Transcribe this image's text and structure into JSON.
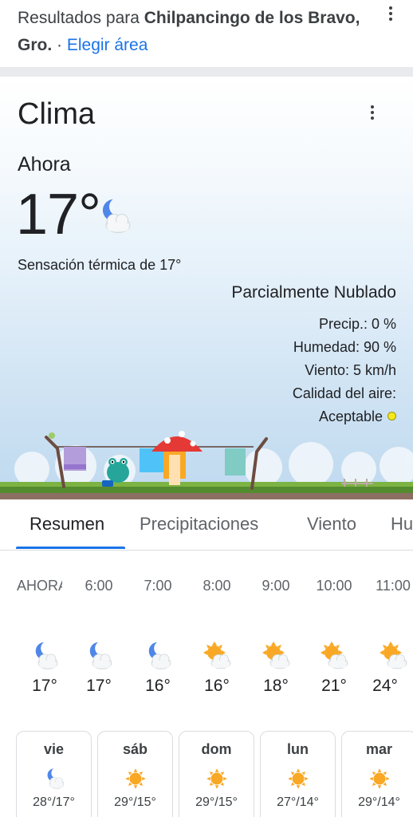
{
  "header": {
    "prefix": "Resultados para ",
    "location": "Chilpancingo de los Bravo, Gro.",
    "separator": " · ",
    "change_area": "Elegir área"
  },
  "weather": {
    "title": "Clima",
    "now_label": "Ahora",
    "temperature": "17°",
    "feels_like": "Sensación térmica de 17°",
    "condition": "Parcialmente Nublado",
    "precip": "Precip.: 0 %",
    "humidity": "Humedad: 90 %",
    "wind": "Viento: 5 km/h",
    "air_quality_label": "Calidad del aire:",
    "air_quality_value": "Aceptable",
    "air_quality_color": "#f8e71c",
    "now_icon": "partly-cloudy-night-icon"
  },
  "tabs": [
    {
      "label": "Resumen",
      "active": true
    },
    {
      "label": "Precipitaciones",
      "active": false
    },
    {
      "label": "Viento",
      "active": false
    },
    {
      "label": "Humedad",
      "active": false
    }
  ],
  "hourly": [
    {
      "time": "AHORA",
      "temp": "17°",
      "icon": "partly-cloudy-night-icon"
    },
    {
      "time": "6:00",
      "temp": "17°",
      "icon": "partly-cloudy-night-icon"
    },
    {
      "time": "7:00",
      "temp": "16°",
      "icon": "partly-cloudy-night-icon"
    },
    {
      "time": "8:00",
      "temp": "16°",
      "icon": "partly-cloudy-day-icon"
    },
    {
      "time": "9:00",
      "temp": "18°",
      "icon": "partly-cloudy-day-icon"
    },
    {
      "time": "10:00",
      "temp": "21°",
      "icon": "partly-cloudy-day-icon"
    },
    {
      "time": "11:00",
      "temp": "24°",
      "icon": "partly-cloudy-day-icon"
    }
  ],
  "daily": [
    {
      "day": "vie",
      "range": "28°/17°",
      "icon": "partly-cloudy-night-icon"
    },
    {
      "day": "sáb",
      "range": "29°/15°",
      "icon": "sunny-icon"
    },
    {
      "day": "dom",
      "range": "29°/15°",
      "icon": "sunny-icon"
    },
    {
      "day": "lun",
      "range": "27°/14°",
      "icon": "sunny-icon"
    },
    {
      "day": "mar",
      "range": "29°/14°",
      "icon": "sunny-icon"
    }
  ],
  "colors": {
    "accent": "#1a73e8",
    "moon": "#4f86e9",
    "sun": "#f9a825"
  }
}
